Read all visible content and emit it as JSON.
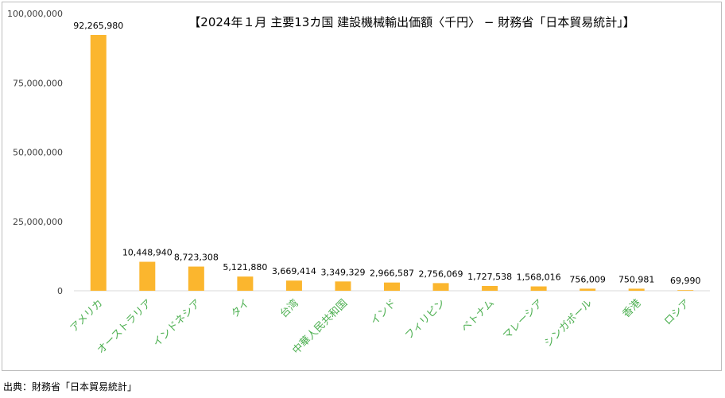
{
  "source_note": "出典：財務省「日本貿易統計」",
  "chart_data": {
    "type": "bar",
    "title": "【2024年１月 主要13カ国 建設機械輸出価額〈千円〉 − 財務省「日本貿易統計」】",
    "categories": [
      "アメリカ",
      "オーストラリア",
      "インドネシア",
      "タイ",
      "台湾",
      "中華人民共和国",
      "インド",
      "フィリピン",
      "ベトナム",
      "マレーシア",
      "シンガポール",
      "香港",
      "ロシア"
    ],
    "values": [
      92265980,
      10448940,
      8723308,
      5121880,
      3669414,
      3349329,
      2966587,
      2756069,
      1727538,
      1568016,
      756009,
      750981,
      69990
    ],
    "value_labels": [
      "92,265,980",
      "10,448,940",
      "8,723,308",
      "5,121,880",
      "3,669,414",
      "3,349,329",
      "2,966,587",
      "2,756,069",
      "1,727,538",
      "1,568,016",
      "756,009",
      "750,981",
      "69,990"
    ],
    "y_ticks": [
      0,
      25000000,
      50000000,
      75000000,
      100000000
    ],
    "y_tick_labels": [
      "0",
      "25,000,000",
      "50,000,000",
      "75,000,000",
      "100,000,000"
    ],
    "ylim": [
      0,
      100000000
    ],
    "xlabel": "",
    "ylabel": "",
    "grid": false,
    "legend": "none",
    "colors": {
      "bar": "#fbb62e",
      "category_label": "#4caf50",
      "axis": "#d9d9d9",
      "text": "#404040"
    }
  }
}
